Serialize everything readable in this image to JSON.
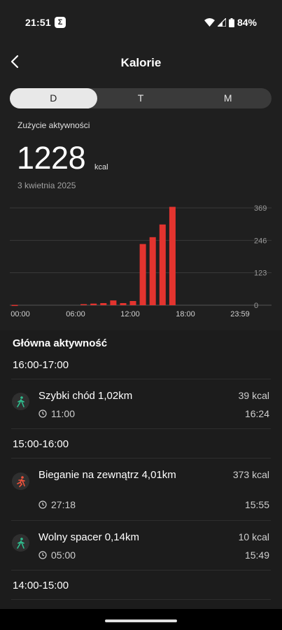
{
  "status_bar": {
    "time": "21:51",
    "app_badge": "Σ",
    "battery": "84%"
  },
  "header": {
    "title": "Kalorie",
    "back_icon": "chevron-left-icon"
  },
  "period_tabs": [
    {
      "label": "D",
      "active": true
    },
    {
      "label": "T",
      "active": false
    },
    {
      "label": "M",
      "active": false
    }
  ],
  "summary": {
    "label": "Zużycie aktywności",
    "value": "1228",
    "unit": "kcal",
    "date": "3 kwietnia 2025"
  },
  "chart_data": {
    "type": "bar",
    "x_ticks": [
      "00:00",
      "06:00",
      "12:00",
      "18:00",
      "23:59"
    ],
    "y_ticks": [
      "369",
      "246",
      "123",
      "0"
    ],
    "ylim": [
      0,
      369
    ],
    "bar_color": "#e3342f",
    "grid": true,
    "hours": [
      0,
      1,
      2,
      3,
      4,
      5,
      6,
      7,
      8,
      9,
      10,
      11,
      12,
      13,
      14,
      15,
      16,
      17,
      18,
      19,
      20,
      21,
      22,
      23
    ],
    "values": [
      1,
      0,
      0,
      0,
      0,
      0,
      0,
      4,
      6,
      8,
      18,
      8,
      16,
      232,
      258,
      306,
      373,
      0,
      0,
      0,
      0,
      0,
      0,
      0
    ]
  },
  "activity": {
    "section_title": "Główna aktywność",
    "groups": [
      {
        "range": "16:00-17:00",
        "items": [
          {
            "name": "Szybki chód 1,02km",
            "kcal": "39 kcal",
            "duration": "11:00",
            "end": "16:24",
            "icon": "walking-icon",
            "color": "#2fbf8f"
          }
        ]
      },
      {
        "range": "15:00-16:00",
        "items": [
          {
            "name": "Bieganie na zewnątrz 4,01km",
            "kcal": "373 kcal",
            "duration": "27:18",
            "end": "15:55",
            "icon": "running-icon",
            "color": "#f0533c"
          },
          {
            "name": "Wolny spacer 0,14km",
            "kcal": "10 kcal",
            "duration": "05:00",
            "end": "15:49",
            "icon": "walking-icon",
            "color": "#2fbf8f"
          }
        ]
      },
      {
        "range": "14:00-15:00",
        "items": []
      }
    ]
  }
}
